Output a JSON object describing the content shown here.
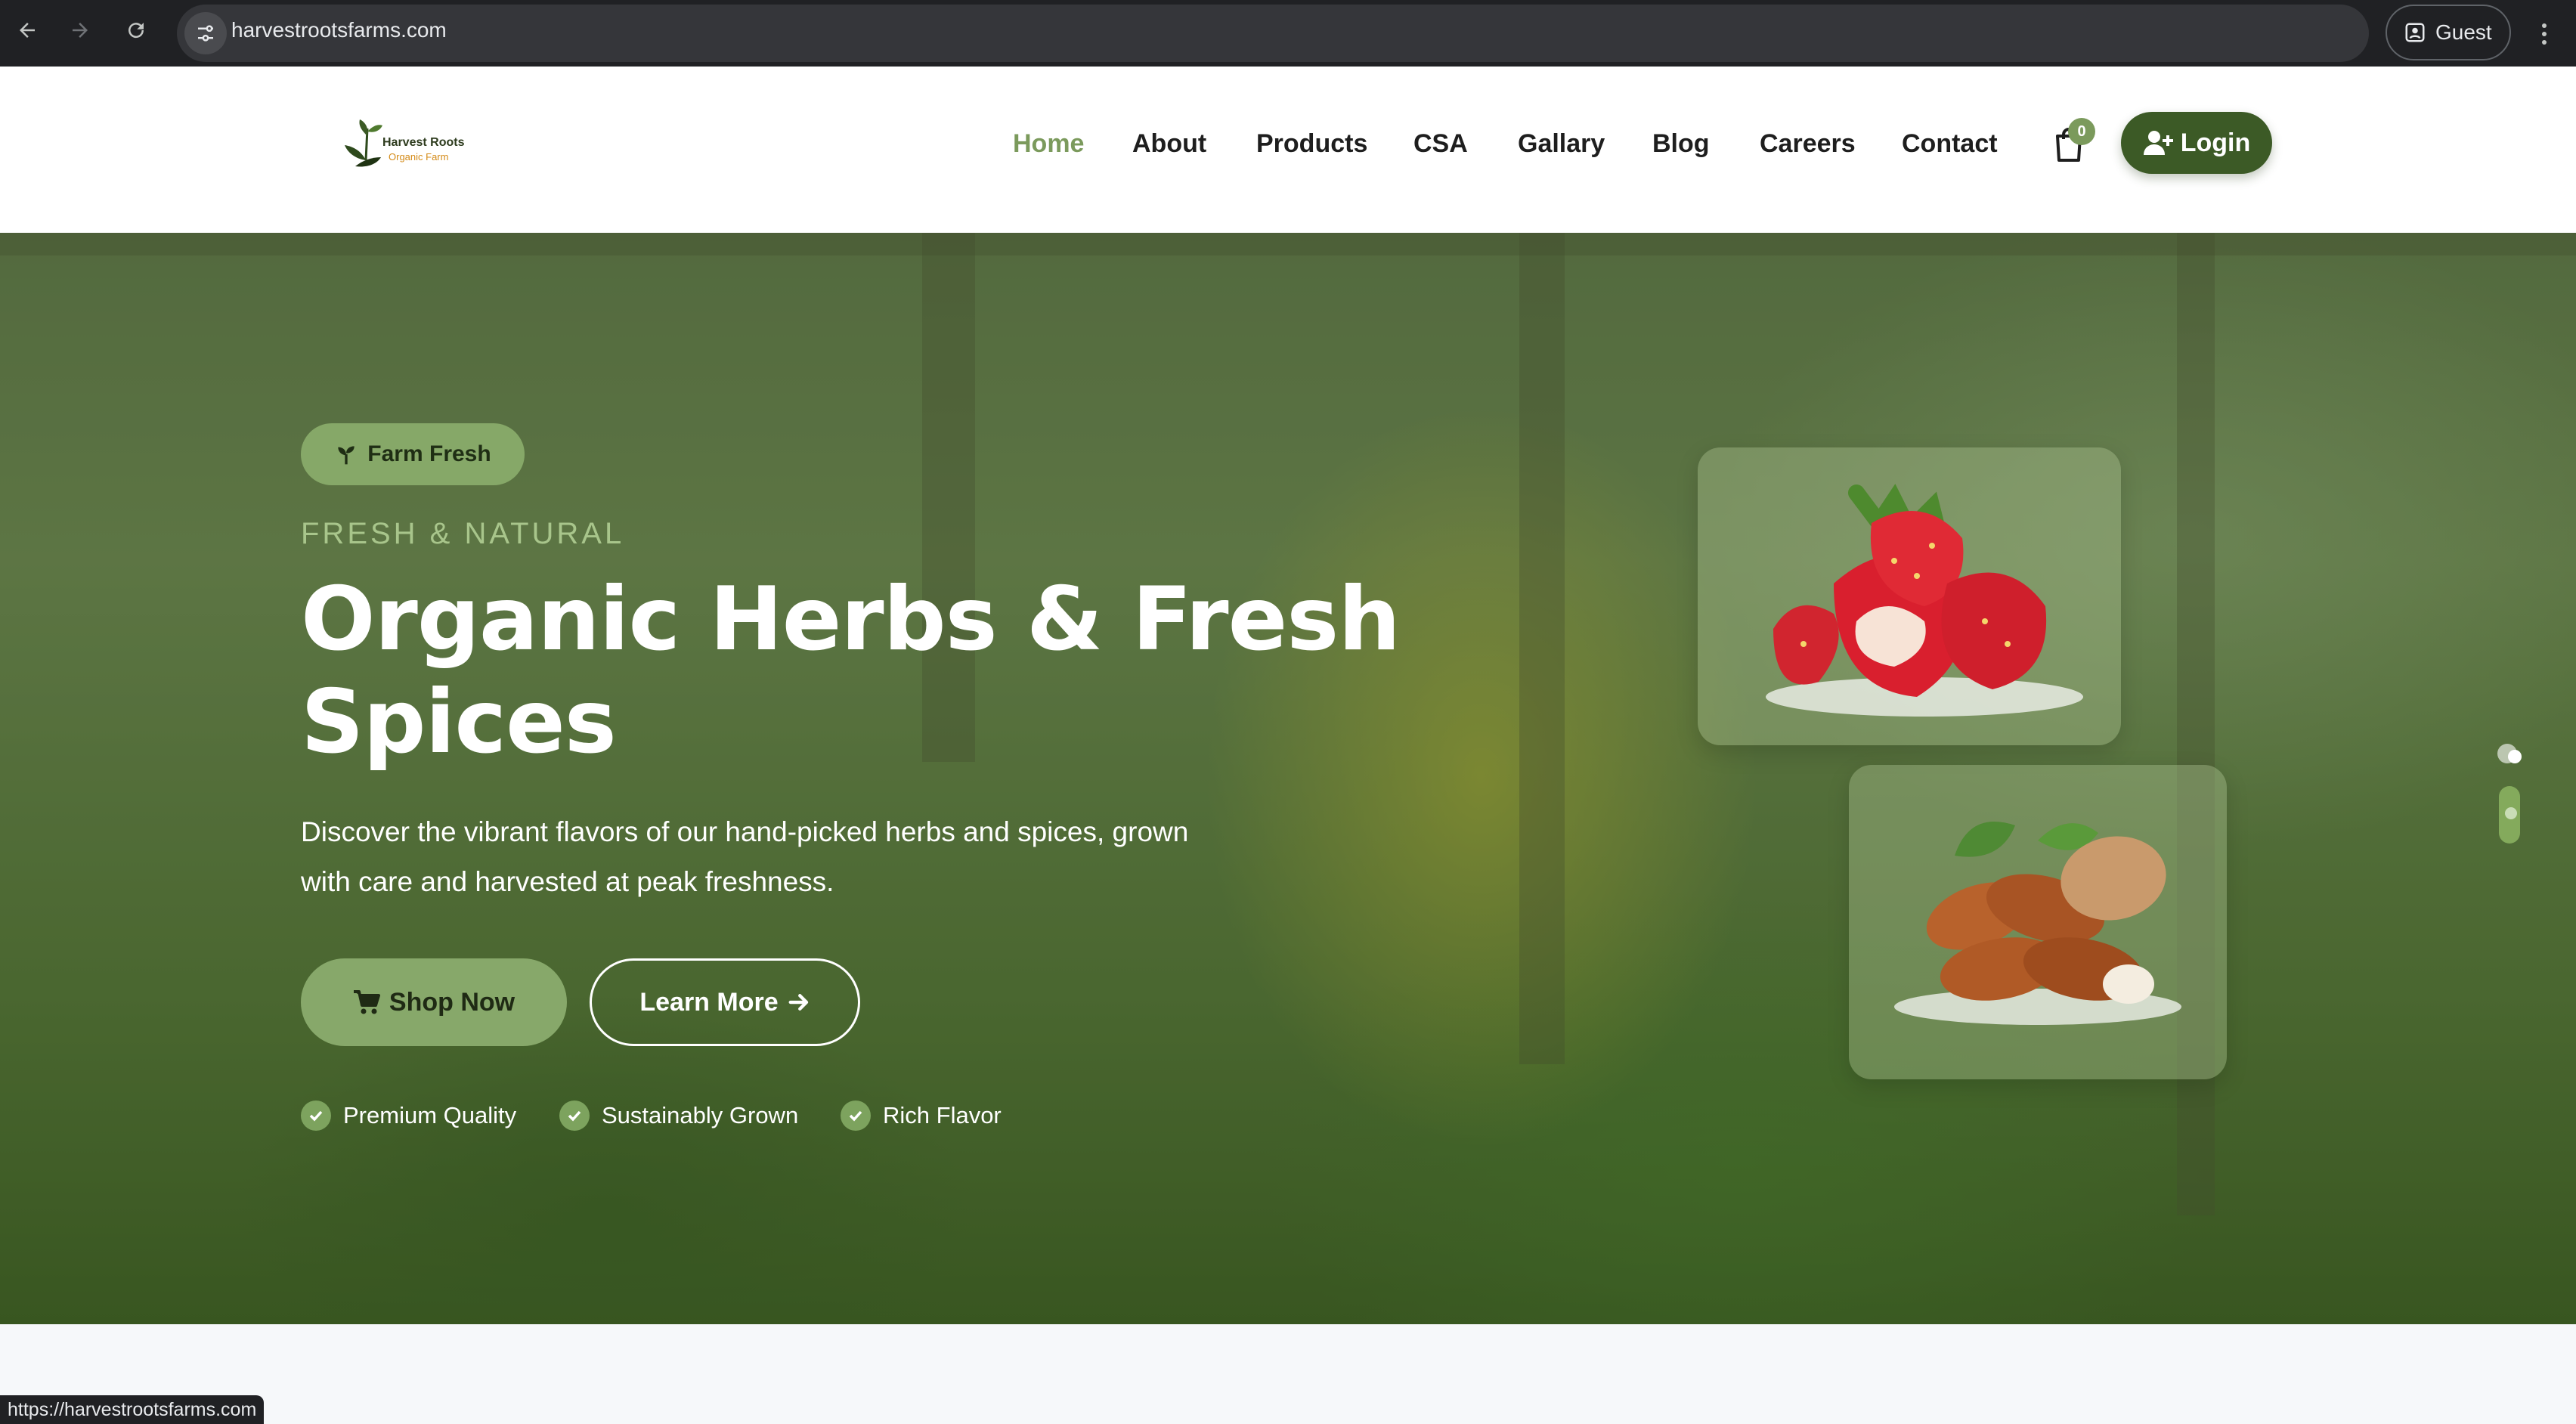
{
  "browser": {
    "url": "harvestrootsfarms.com",
    "profile_label": "Guest",
    "status_url": "https://harvestrootsfarms.com"
  },
  "logo": {
    "title": "Harvest Roots",
    "subtitle": "Organic Farm"
  },
  "nav": {
    "items": [
      {
        "label": "Home",
        "active": true
      },
      {
        "label": "About"
      },
      {
        "label": "Products"
      },
      {
        "label": "CSA"
      },
      {
        "label": "Gallary"
      },
      {
        "label": "Blog"
      },
      {
        "label": "Careers"
      },
      {
        "label": "Contact"
      }
    ],
    "cart_count": "0",
    "login_label": "Login"
  },
  "hero": {
    "badge": "Farm Fresh",
    "eyebrow": "FRESH & NATURAL",
    "headline": "Organic Herbs & Fresh Spices",
    "description": "Discover the vibrant flavors of our hand-picked herbs and spices, grown with care and harvested at peak freshness.",
    "shop_button": "Shop Now",
    "learn_button": "Learn More",
    "features": [
      "Premium Quality",
      "Sustainably Grown",
      "Rich Flavor"
    ]
  },
  "colors": {
    "accent": "#7b9a5c",
    "login_bg": "#3c5a26",
    "chrome": "#202124"
  },
  "icons": [
    "back-icon",
    "forward-icon",
    "reload-icon",
    "site-info-icon",
    "profile-icon",
    "menu-icon",
    "cart-icon",
    "user-plus-icon",
    "sprout-icon",
    "shopping-cart-icon",
    "arrow-right-icon",
    "check-icon"
  ]
}
